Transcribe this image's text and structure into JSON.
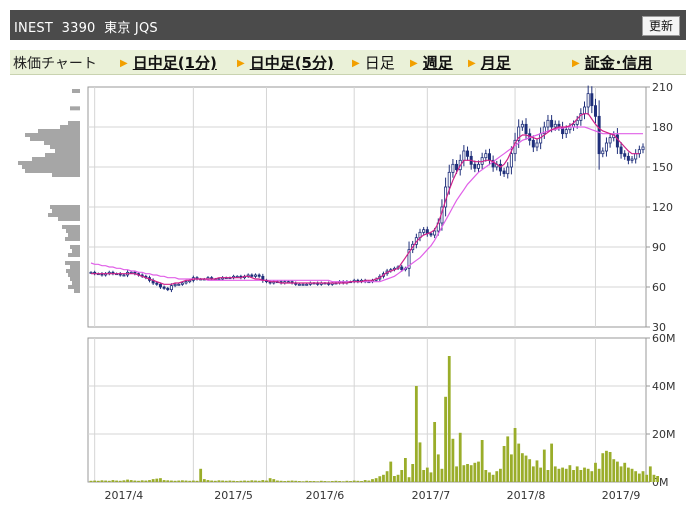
{
  "header": {
    "title": "INEST  3390  東京 JQS",
    "refresh_label": "更新"
  },
  "tabs": {
    "chart_label": "株価チャート",
    "items": [
      {
        "label": "日中足(1分)",
        "current": false
      },
      {
        "label": "日中足(5分)",
        "current": false
      },
      {
        "label": "日足",
        "current": true
      },
      {
        "label": "週足",
        "current": false
      },
      {
        "label": "月足",
        "current": false
      },
      {
        "label": "証金･信用",
        "current": false
      }
    ]
  },
  "colors": {
    "candle_up": "#ffffff",
    "candle_down": "#1f2f7a",
    "ma_short": "#d0208a",
    "ma_long": "#e060e8",
    "volume": "#9aad2a",
    "volume_profile": "#a6a6a6",
    "grid": "#d5d5d5"
  },
  "chart_data": [
    {
      "type": "candlestick",
      "title": "",
      "ylim": [
        30,
        210
      ],
      "yticks": [
        "210",
        "180",
        "150",
        "120",
        "90",
        "60",
        "30"
      ],
      "xticks": [
        "2017/4",
        "2017/5",
        "2017/6",
        "2017/7",
        "2017/8",
        "2017/9"
      ],
      "grid": true,
      "close": [
        71,
        70,
        70,
        69,
        70,
        71,
        70,
        70,
        69,
        69,
        71,
        71,
        70,
        69,
        68,
        67,
        65,
        63,
        62,
        60,
        59,
        58,
        61,
        62,
        62,
        63,
        64,
        65,
        67,
        66,
        66,
        66,
        67,
        66,
        66,
        66,
        67,
        67,
        67,
        68,
        68,
        67,
        68,
        69,
        68,
        69,
        68,
        65,
        64,
        63,
        64,
        64,
        63,
        64,
        64,
        63,
        62,
        62,
        62,
        62,
        63,
        63,
        62,
        63,
        63,
        62,
        63,
        63,
        64,
        63,
        64,
        64,
        65,
        64,
        65,
        64,
        64,
        65,
        66,
        68,
        70,
        72,
        73,
        74,
        75,
        73,
        74,
        88,
        92,
        97,
        101,
        103,
        100,
        99,
        102,
        108,
        120,
        135,
        146,
        152,
        148,
        155,
        162,
        158,
        152,
        149,
        152,
        157,
        160,
        155,
        150,
        152,
        147,
        145,
        150,
        160,
        170,
        180,
        182,
        175,
        170,
        165,
        168,
        175,
        180,
        185,
        180,
        182,
        180,
        175,
        178,
        180,
        182,
        185,
        190,
        195,
        205,
        196,
        188,
        160,
        162,
        168,
        172,
        174,
        165,
        160,
        158,
        155,
        156,
        160,
        163,
        165
      ],
      "ma_short": [
        70,
        70,
        70,
        70,
        70,
        70,
        70,
        70,
        70,
        70,
        70,
        70,
        70,
        69,
        68,
        67,
        66,
        65,
        64,
        63,
        62,
        62,
        62,
        63,
        63,
        64,
        65,
        65,
        66,
        66,
        66,
        66,
        66,
        66,
        66,
        67,
        67,
        67,
        67,
        67,
        67,
        67,
        68,
        68,
        67,
        66,
        66,
        65,
        65,
        64,
        64,
        64,
        63,
        63,
        63,
        63,
        63,
        63,
        63,
        63,
        63,
        63,
        63,
        63,
        63,
        63,
        63,
        63,
        63,
        63,
        63,
        64,
        64,
        64,
        64,
        65,
        65,
        65,
        66,
        67,
        69,
        71,
        72,
        73,
        74,
        78,
        82,
        86,
        90,
        94,
        97,
        99,
        100,
        101,
        103,
        108,
        116,
        125,
        133,
        140,
        146,
        151,
        155,
        155,
        155,
        154,
        154,
        154,
        155,
        155,
        154,
        152,
        150,
        152,
        156,
        162,
        168,
        172,
        174,
        174,
        173,
        172,
        171,
        172,
        174,
        176,
        178,
        179,
        180,
        180,
        180,
        181,
        183,
        186,
        189,
        190,
        190,
        186,
        182,
        179,
        177,
        176,
        175,
        174,
        171,
        168,
        165,
        162,
        160,
        160,
        160
      ],
      "ma_long": [
        78,
        77,
        77,
        76,
        76,
        75,
        75,
        74,
        74,
        73,
        73,
        72,
        72,
        71,
        71,
        70,
        70,
        69,
        69,
        68,
        68,
        67,
        67,
        67,
        66,
        66,
        66,
        66,
        66,
        66,
        66,
        66,
        65,
        65,
        65,
        65,
        65,
        65,
        65,
        65,
        65,
        65,
        65,
        65,
        65,
        65,
        65,
        65,
        65,
        65,
        65,
        65,
        65,
        65,
        65,
        65,
        65,
        65,
        65,
        65,
        65,
        65,
        65,
        65,
        65,
        65,
        64,
        64,
        64,
        64,
        64,
        64,
        64,
        64,
        64,
        64,
        64,
        64,
        64,
        64,
        65,
        66,
        67,
        68,
        70,
        72,
        74,
        76,
        78,
        80,
        82,
        85,
        88,
        91,
        95,
        100,
        105,
        110,
        115,
        120,
        125,
        129,
        133,
        137,
        140,
        143,
        146,
        148,
        150,
        152,
        154,
        156,
        158,
        160,
        162,
        164,
        166,
        168,
        170,
        171,
        172,
        173,
        174,
        175,
        176,
        177,
        178,
        178,
        179,
        179,
        180,
        180,
        180,
        180,
        180,
        180,
        179,
        178,
        177,
        176,
        175,
        175,
        175,
        175,
        175,
        175,
        175,
        175,
        175,
        175,
        175,
        175
      ],
      "volume_profile_rows": [
        {
          "price": 207,
          "w": 8
        },
        {
          "price": 194,
          "w": 10
        },
        {
          "price": 183,
          "w": 12
        },
        {
          "price": 180,
          "w": 20
        },
        {
          "price": 177,
          "w": 42
        },
        {
          "price": 174,
          "w": 55
        },
        {
          "price": 171,
          "w": 50
        },
        {
          "price": 168,
          "w": 36
        },
        {
          "price": 165,
          "w": 30
        },
        {
          "price": 162,
          "w": 25
        },
        {
          "price": 159,
          "w": 35
        },
        {
          "price": 156,
          "w": 48
        },
        {
          "price": 153,
          "w": 62
        },
        {
          "price": 150,
          "w": 58
        },
        {
          "price": 147,
          "w": 55
        },
        {
          "price": 144,
          "w": 28
        },
        {
          "price": 120,
          "w": 30
        },
        {
          "price": 117,
          "w": 28
        },
        {
          "price": 114,
          "w": 32
        },
        {
          "price": 111,
          "w": 22
        },
        {
          "price": 105,
          "w": 18
        },
        {
          "price": 102,
          "w": 14
        },
        {
          "price": 99,
          "w": 12
        },
        {
          "price": 96,
          "w": 15
        },
        {
          "price": 90,
          "w": 10
        },
        {
          "price": 87,
          "w": 8
        },
        {
          "price": 84,
          "w": 12
        },
        {
          "price": 78,
          "w": 15
        },
        {
          "price": 75,
          "w": 10
        },
        {
          "price": 72,
          "w": 14
        },
        {
          "price": 69,
          "w": 12
        },
        {
          "price": 66,
          "w": 10
        },
        {
          "price": 63,
          "w": 8
        },
        {
          "price": 60,
          "w": 12
        },
        {
          "price": 57,
          "w": 6
        }
      ]
    },
    {
      "type": "bar",
      "title": "",
      "ylim": [
        0,
        60
      ],
      "yticks": [
        "60M",
        "40M",
        "20M",
        "0M"
      ],
      "unit": "M",
      "values": [
        0.5,
        0.6,
        0.5,
        0.7,
        0.6,
        0.5,
        0.8,
        0.6,
        0.5,
        0.7,
        1.0,
        0.8,
        0.6,
        0.5,
        0.7,
        0.6,
        0.8,
        1.2,
        1.4,
        1.6,
        0.8,
        0.7,
        0.6,
        0.5,
        0.6,
        0.7,
        0.6,
        0.5,
        0.6,
        0.5,
        5.5,
        1.2,
        0.8,
        0.6,
        0.5,
        0.7,
        0.6,
        0.5,
        0.6,
        0.5,
        0.4,
        0.5,
        0.6,
        0.5,
        0.7,
        0.6,
        0.5,
        0.8,
        0.6,
        1.6,
        1.2,
        0.6,
        0.5,
        0.4,
        0.5,
        0.6,
        0.5,
        0.4,
        0.3,
        0.5,
        0.4,
        0.4,
        0.3,
        0.5,
        0.4,
        0.3,
        0.4,
        0.5,
        0.4,
        0.3,
        0.5,
        0.4,
        0.6,
        0.5,
        0.4,
        0.8,
        0.6,
        1.2,
        1.6,
        2.4,
        3.0,
        4.5,
        8.5,
        2.5,
        3.0,
        5.0,
        10.0,
        2.0,
        7.5,
        40.0,
        16.5,
        5.0,
        6.0,
        4.0,
        25.0,
        11.5,
        5.5,
        35.5,
        52.5,
        18.0,
        6.5,
        20.5,
        7.0,
        7.5,
        7.0,
        8.0,
        8.5,
        17.5,
        5.0,
        4.0,
        3.0,
        4.5,
        5.5,
        15.0,
        19.0,
        11.5,
        22.5,
        16.0,
        12.0,
        11.0,
        9.5,
        6.5,
        9.0,
        6.0,
        13.5,
        5.0,
        16.0,
        6.5,
        5.5,
        6.0,
        5.5,
        7.0,
        5.0,
        6.5,
        5.0,
        6.0,
        5.5,
        4.5,
        8.0,
        5.5,
        12.0,
        13.0,
        12.5,
        9.5,
        8.5,
        6.5,
        8.0,
        6.0,
        5.5,
        4.5,
        3.5,
        4.5,
        3.0,
        6.5,
        3.0,
        2.5
      ],
      "grid": true
    }
  ]
}
